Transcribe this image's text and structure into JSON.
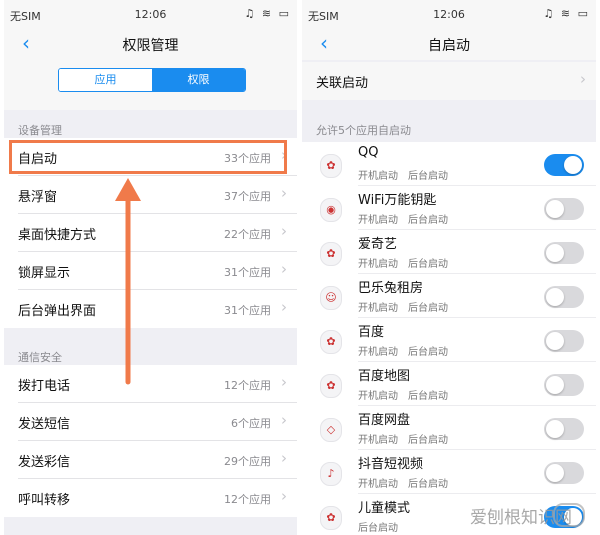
{
  "left": {
    "status": {
      "carrier": "无SIM",
      "time": "12:06",
      "icons": "♫ ≋ ▭"
    },
    "nav": {
      "title": "权限管理"
    },
    "segments": {
      "app": "应用",
      "perm": "权限"
    },
    "section_device": "设备管理",
    "device_rows": [
      {
        "label": "自启动",
        "count": "33个应用"
      },
      {
        "label": "悬浮窗",
        "count": "37个应用"
      },
      {
        "label": "桌面快捷方式",
        "count": "22个应用"
      },
      {
        "label": "锁屏显示",
        "count": "31个应用"
      },
      {
        "label": "后台弹出界面",
        "count": "31个应用"
      }
    ],
    "section_comm": "通信安全",
    "comm_rows": [
      {
        "label": "拨打电话",
        "count": "12个应用"
      },
      {
        "label": "发送短信",
        "count": "6个应用"
      },
      {
        "label": "发送彩信",
        "count": "29个应用"
      },
      {
        "label": "呼叫转移",
        "count": "12个应用"
      }
    ]
  },
  "right": {
    "status": {
      "carrier": "无SIM",
      "time": "12:06",
      "icons": "♫ ≋ ▭"
    },
    "nav": {
      "title": "自启动"
    },
    "linked": {
      "label": "关联启动"
    },
    "section": "允许5个应用自启动",
    "apps": [
      {
        "name": "QQ",
        "perms": [
          "开机启动",
          "后台启动"
        ],
        "enabled": true
      },
      {
        "name": "WiFi万能钥匙",
        "perms": [
          "开机启动",
          "后台启动"
        ],
        "enabled": false
      },
      {
        "name": "爱奇艺",
        "perms": [
          "开机启动",
          "后台启动"
        ],
        "enabled": false
      },
      {
        "name": "巴乐兔租房",
        "perms": [
          "开机启动",
          "后台启动"
        ],
        "enabled": false
      },
      {
        "name": "百度",
        "perms": [
          "开机启动",
          "后台启动"
        ],
        "enabled": false
      },
      {
        "name": "百度地图",
        "perms": [
          "开机启动",
          "后台启动"
        ],
        "enabled": false
      },
      {
        "name": "百度网盘",
        "perms": [
          "开机启动",
          "后台启动"
        ],
        "enabled": false
      },
      {
        "name": "抖音短视频",
        "perms": [
          "开机启动",
          "后台启动"
        ],
        "enabled": false
      },
      {
        "name": "儿童模式",
        "perms": [
          "后台启动"
        ],
        "enabled": true
      }
    ]
  },
  "watermark": "爱刨根知识网",
  "colors": {
    "accent": "#1a8cef",
    "highlight": "#f07a4a"
  }
}
